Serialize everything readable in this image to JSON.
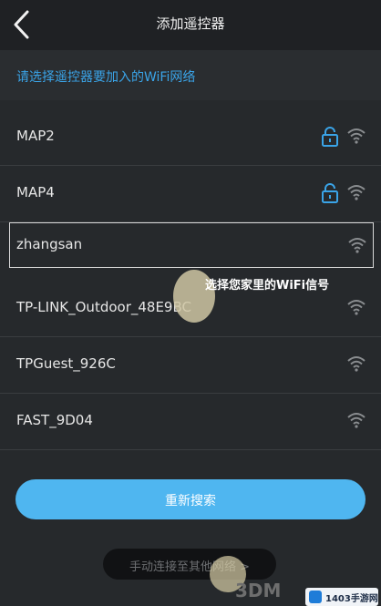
{
  "header": {
    "title": "添加遥控器"
  },
  "prompt": {
    "text": "请选择遥控器要加入的WiFi网络"
  },
  "networks": [
    {
      "ssid": "MAP2",
      "locked": true
    },
    {
      "ssid": "MAP4",
      "locked": true
    },
    {
      "ssid": "zhangsan",
      "locked": false,
      "selected": true
    },
    {
      "ssid": "TP-LINK_Outdoor_48E9BC",
      "locked": false
    },
    {
      "ssid": "TPGuest_926C",
      "locked": false
    },
    {
      "ssid": "FAST_9D04",
      "locked": false
    }
  ],
  "annotation": {
    "text": "选择您家里的WiFi信号"
  },
  "buttons": {
    "refresh_label": "重新搜索",
    "manual_label": "手动连接至其他网络 >"
  },
  "watermarks": {
    "site": "3DM",
    "badge": "1403手游网"
  },
  "colors": {
    "accent": "#3aa4e8",
    "button": "#4fb6f0",
    "background": "#26292c"
  }
}
